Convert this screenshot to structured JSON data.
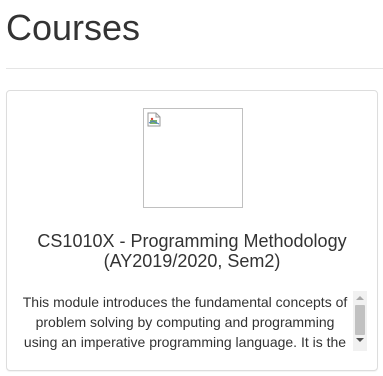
{
  "page": {
    "title": "Courses"
  },
  "course": {
    "title_line1": "CS1010X - Programming Methodology",
    "title_line2": "(AY2019/2020, Sem2)",
    "image_icon": "broken-image-icon",
    "description": "This module introduces the fundamental concepts of problem solving by computing and programming using an imperative programming language. It is the"
  },
  "colors": {
    "text": "#333333",
    "border": "#dddddd",
    "divider": "#e5e5e5",
    "scrollbar_track": "#f1f1f1",
    "scrollbar_thumb": "#c1c1c1"
  }
}
